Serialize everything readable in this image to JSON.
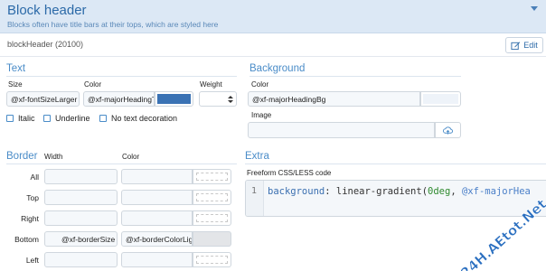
{
  "header": {
    "title": "Block header",
    "subtitle": "Blocks often have title bars at their tops, which are styled here"
  },
  "meta": {
    "identifier": "blockHeader (20100)"
  },
  "edit_button": {
    "label": "Edit"
  },
  "text_section": {
    "title": "Text",
    "size_label": "Size",
    "size_value": "@xf-fontSizeLarger",
    "color_label": "Color",
    "color_value": "@xf-majorHeadingTextColor",
    "color_swatch": "#3a72b4",
    "weight_label": "Weight",
    "weight_value": "",
    "options": [
      {
        "label": "Italic",
        "checked": false
      },
      {
        "label": "Underline",
        "checked": false
      },
      {
        "label": "No text decoration",
        "checked": false
      }
    ]
  },
  "background_section": {
    "title": "Background",
    "color_label": "Color",
    "color_value": "@xf-majorHeadingBg",
    "color_swatch": "#eef3f9",
    "image_label": "Image",
    "image_value": ""
  },
  "border_section": {
    "title": "Border",
    "width_header": "Width",
    "color_header": "Color",
    "rows": [
      {
        "side": "All",
        "width": "",
        "color": ""
      },
      {
        "side": "Top",
        "width": "",
        "color": ""
      },
      {
        "side": "Right",
        "width": "",
        "color": ""
      },
      {
        "side": "Bottom",
        "width": "@xf-borderSize",
        "color": "@xf-borderColorLight"
      },
      {
        "side": "Left",
        "width": "",
        "color": ""
      }
    ]
  },
  "extra_section": {
    "title": "Extra",
    "css_label": "Freeform CSS/LESS code",
    "line_number": "1",
    "code_property": "background",
    "code_sep": ": ",
    "code_func": "linear-gradient(",
    "code_arg": "0deg",
    "code_rest": ", ",
    "code_var": "@xf-majorHea"
  },
  "watermark": "24H.AEtot.Net",
  "colors": {
    "accent": "#4a8cc8",
    "header_bg": "#dce8f5"
  }
}
